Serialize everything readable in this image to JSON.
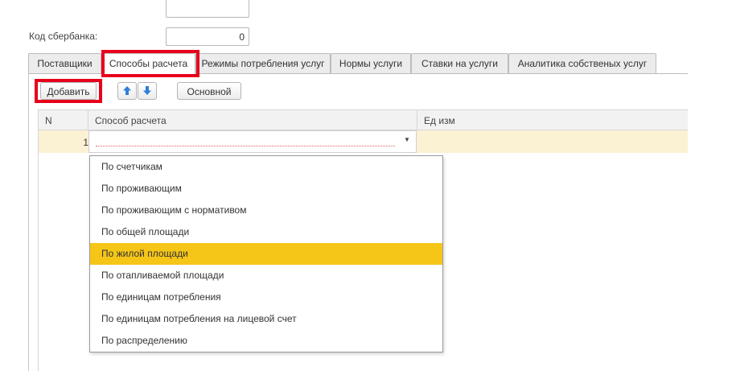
{
  "form": {
    "sber_code_label": "Код сбербанка:",
    "sber_code_value": "0"
  },
  "tabs": [
    {
      "label": "Поставщики",
      "active": false
    },
    {
      "label": "Способы расчета",
      "active": true
    },
    {
      "label": "Режимы потребления услуг",
      "active": false
    },
    {
      "label": "Нормы услуги",
      "active": false
    },
    {
      "label": "Ставки на услуги",
      "active": false
    },
    {
      "label": "Аналитика собственых услуг",
      "active": false
    }
  ],
  "toolbar": {
    "add_label": "Добавить",
    "move_up_icon": "arrow-up-icon",
    "move_down_icon": "arrow-down-icon",
    "main_label": "Основной"
  },
  "table": {
    "columns": [
      "N",
      "Способ расчета",
      "Ед изм"
    ],
    "rows": [
      {
        "n": "1",
        "method": "",
        "unit": ""
      }
    ]
  },
  "dropdown": {
    "icon": "chevron-down-icon",
    "options": [
      "По счетчикам",
      "По проживающим",
      "По проживающим с нормативом",
      "По общей площади",
      "По жилой площади",
      "По отапливаемой площади",
      "По единицам потребления",
      "По единицам потребления на лицевой счет",
      "По распределению"
    ],
    "selected_index": 4
  },
  "colors": {
    "highlight_red": "#e8001c",
    "row_yellow": "#fbf1d3",
    "selection_yellow": "#f5c518",
    "arrow_blue": "#2f7fd8"
  }
}
